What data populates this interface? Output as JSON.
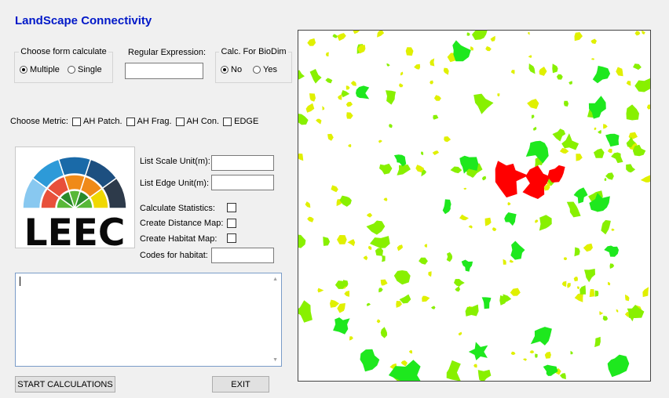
{
  "app": {
    "title": "LandScape Connectivity"
  },
  "form_calc": {
    "legend": "Choose form calculate",
    "options": [
      {
        "label": "Multiple",
        "selected": true
      },
      {
        "label": "Single",
        "selected": false
      }
    ]
  },
  "regex": {
    "label": "Regular Expression:",
    "value": ""
  },
  "biodim": {
    "legend": "Calc. For BioDim",
    "options": [
      {
        "label": "No",
        "selected": true
      },
      {
        "label": "Yes",
        "selected": false
      }
    ]
  },
  "metric": {
    "label": "Choose Metric:",
    "items": [
      {
        "label": "AH Patch.",
        "checked": false
      },
      {
        "label": "AH Frag.",
        "checked": false
      },
      {
        "label": "AH Con.",
        "checked": false
      },
      {
        "label": "EDGE",
        "checked": false
      }
    ]
  },
  "logo": {
    "text": "LEEC",
    "colors": [
      "#88c8f0",
      "#2d9ad8",
      "#1a6aa8",
      "#1d4f80",
      "#2d3a4a",
      "#f0d800",
      "#f08a18",
      "#e8503a",
      "#58b838",
      "#2a8a2a"
    ]
  },
  "settings": {
    "scale_label": "List Scale Unit(m):",
    "scale_value": "",
    "edge_label": "List Edge Unit(m):",
    "edge_value": "",
    "stats_label": "Calculate Statistics:",
    "distance_label": "Create Distance Map:",
    "habitat_map_label": "Create Habitat Map:",
    "codes_label": "Codes for habitat:",
    "codes_value": ""
  },
  "log": {
    "value": ""
  },
  "buttons": {
    "start": "START CALCULATIONS",
    "exit": "EXIT"
  },
  "map": {
    "colors": {
      "red": "#ff0000",
      "green": "#1ee81e",
      "lime": "#88f000",
      "yellow": "#e0f000"
    }
  }
}
